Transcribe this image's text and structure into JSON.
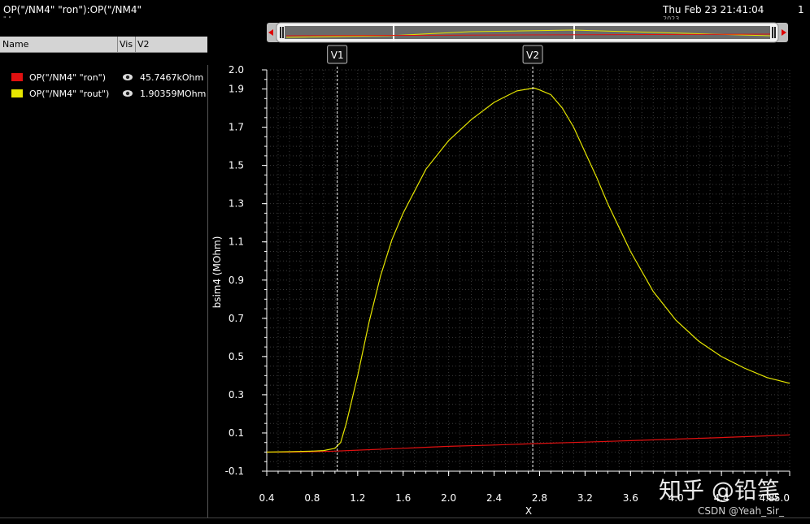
{
  "window": {
    "title": "OP(\"/NM4\" \"ron\"):OP(\"/NM4\"",
    "subtitle": "\" \"...",
    "date": "Thu Feb 23 21:41:04",
    "date_line2": "2023",
    "page_number": "1"
  },
  "legend": {
    "headers": [
      "Name",
      "Vis",
      "V2"
    ],
    "items": [
      {
        "name": "OP(\"/NM4\" \"ron\")",
        "value": "45.7467kOhm",
        "color": "#e01010",
        "icon": "eye-icon"
      },
      {
        "name": "OP(\"/NM4\" \"rout\")",
        "value": "1.90359MOhm",
        "color": "#e6e600",
        "icon": "eye-icon"
      }
    ]
  },
  "watermark": {
    "main": "知乎 @铅笔",
    "credit": "CSDN @Yeah_Sir_"
  },
  "chart_data": {
    "type": "line",
    "title": "",
    "xlabel": "X",
    "ylabel": "bsim4 (MOhm)",
    "xlim": [
      0.4,
      5.0
    ],
    "ylim": [
      -0.1,
      2.0
    ],
    "x_ticks": [
      0.4,
      0.8,
      1.2,
      1.6,
      2.0,
      2.4,
      2.8,
      3.2,
      3.6,
      4.0,
      4.4,
      4.8,
      5.0
    ],
    "x_tick_labels": [
      "0.4",
      "0.8",
      "1.2",
      "1.6",
      "2.0",
      "2.4",
      "2.8",
      "3.2",
      "3.6",
      "4.0",
      "4.4",
      "4.8",
      "5.0"
    ],
    "y_ticks": [
      -0.1,
      0.1,
      0.3,
      0.5,
      0.7,
      0.9,
      1.1,
      1.3,
      1.5,
      1.7,
      1.9,
      2.0
    ],
    "y_tick_labels": [
      "-0.1",
      "0.1",
      "0.3",
      "0.5",
      "0.7",
      "0.9",
      "1.1",
      "1.3",
      "1.5",
      "1.7",
      "1.9",
      "2.0"
    ],
    "grid": true,
    "markers": [
      {
        "label": "V1",
        "x": 1.02
      },
      {
        "label": "V2",
        "x": 2.74
      }
    ],
    "series": [
      {
        "name": "OP(\"/NM4\" \"ron\")",
        "color": "#e01010",
        "x": [
          0.4,
          0.6,
          0.8,
          1.0,
          1.2,
          1.6,
          2.0,
          2.4,
          2.8,
          3.2,
          3.6,
          4.0,
          4.4,
          4.8,
          5.0
        ],
        "y": [
          0.0,
          0.0,
          0.002,
          0.005,
          0.01,
          0.02,
          0.03,
          0.037,
          0.045,
          0.052,
          0.06,
          0.068,
          0.076,
          0.085,
          0.09
        ]
      },
      {
        "name": "OP(\"/NM4\" \"rout\")",
        "color": "#e6e600",
        "x": [
          0.4,
          0.6,
          0.8,
          0.9,
          1.0,
          1.05,
          1.1,
          1.2,
          1.3,
          1.4,
          1.5,
          1.6,
          1.8,
          2.0,
          2.2,
          2.4,
          2.5,
          2.6,
          2.7,
          2.75,
          2.8,
          2.9,
          3.0,
          3.1,
          3.2,
          3.3,
          3.4,
          3.6,
          3.8,
          4.0,
          4.2,
          4.4,
          4.6,
          4.8,
          5.0
        ],
        "y": [
          0.0,
          0.002,
          0.005,
          0.008,
          0.02,
          0.05,
          0.15,
          0.4,
          0.68,
          0.92,
          1.11,
          1.25,
          1.48,
          1.63,
          1.74,
          1.83,
          1.86,
          1.89,
          1.9,
          1.905,
          1.895,
          1.87,
          1.8,
          1.7,
          1.57,
          1.44,
          1.3,
          1.05,
          0.84,
          0.69,
          0.58,
          0.5,
          0.44,
          0.39,
          0.36
        ]
      }
    ]
  }
}
